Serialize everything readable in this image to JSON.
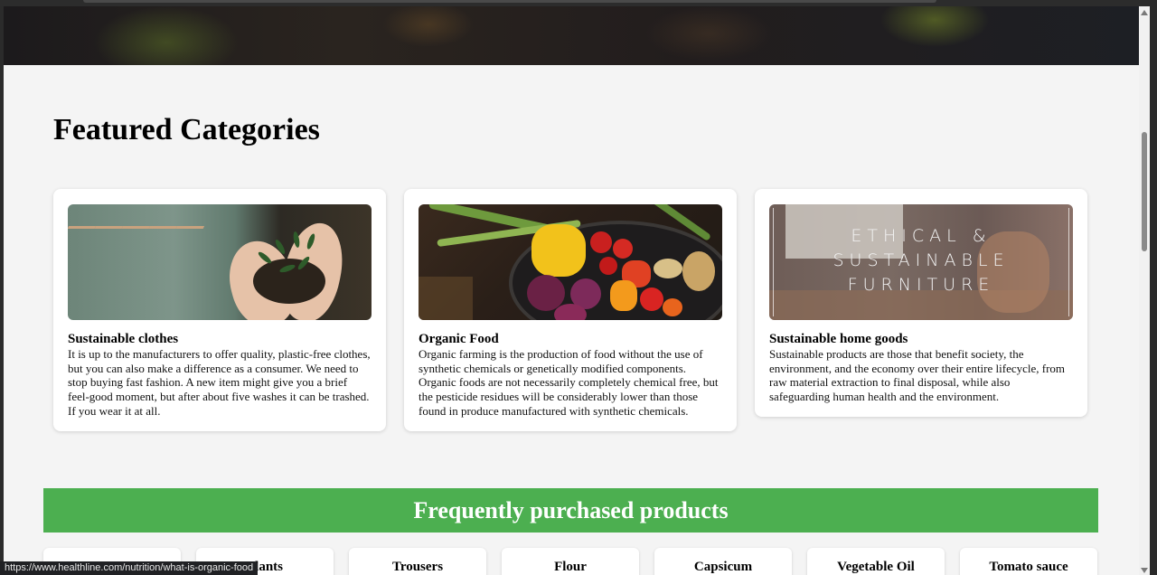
{
  "featured": {
    "title": "Featured Categories",
    "cards": [
      {
        "title": "Sustainable clothes",
        "text": "It is up to the manufacturers to offer quality, plastic-free clothes, but you can also make a difference as a consumer. We need to stop buying fast fashion. A new item might give you a brief feel-good moment, but after about five washes it can be trashed. If you wear it at all."
      },
      {
        "title": "Organic Food",
        "text": "Organic farming is the production of food without the use of synthetic chemicals or genetically modified components. Organic foods are not necessarily completely chemical free, but the pesticide residues will be considerably lower than those found in produce manufactured with synthetic chemicals."
      },
      {
        "title": "Sustainable home goods",
        "image_text": [
          "ETHICAL &",
          "SUSTAINABLE",
          "FURNITURE"
        ],
        "text": "Sustainable products are those that benefit society, the environment, and the economy over their entire lifecycle, from raw material extraction to final disposal, while also safeguarding human health and the environment."
      }
    ]
  },
  "products": {
    "title": "Frequently purchased products",
    "items": [
      "Plants",
      "Trousers",
      "Flour",
      "Capsicum",
      "Vegetable Oil",
      "Tomato sauce"
    ]
  },
  "status_url": "https://www.healthline.com/nutrition/what-is-organic-food",
  "colors": {
    "banner": "#4caf50",
    "page_bg": "#f4f4f4"
  }
}
